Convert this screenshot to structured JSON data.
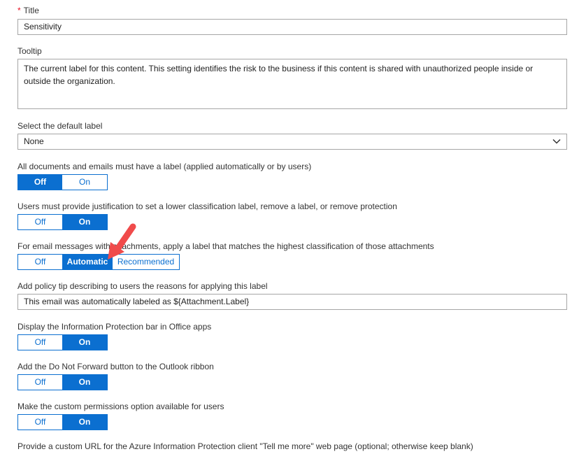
{
  "title_field": {
    "required_mark": "*",
    "label": "Title",
    "value": "Sensitivity"
  },
  "tooltip_field": {
    "label": "Tooltip",
    "value": "The current label for this content. This setting identifies the risk to the business if this content is shared with unauthorized people inside or outside the organization."
  },
  "default_label": {
    "label": "Select the default label",
    "selected": "None"
  },
  "mandatory_label": {
    "label": "All documents and emails must have a label (applied automatically or by users)",
    "off": "Off",
    "on": "On",
    "state": "Off"
  },
  "justification": {
    "label": "Users must provide justification to set a lower classification label, remove a label, or remove protection",
    "off": "Off",
    "on": "On",
    "state": "On"
  },
  "email_attachments": {
    "label": "For email messages with attachments, apply a label that matches the highest classification of those attachments",
    "off": "Off",
    "automatic": "Automatic",
    "recommended": "Recommended",
    "state": "Automatic"
  },
  "policy_tip": {
    "label": "Add policy tip describing to users the reasons for applying this label",
    "value": "This email was automatically labeled as ${Attachment.Label}"
  },
  "info_bar": {
    "label": "Display the Information Protection bar in Office apps",
    "off": "Off",
    "on": "On",
    "state": "On"
  },
  "do_not_forward": {
    "label": "Add the Do Not Forward button to the Outlook ribbon",
    "off": "Off",
    "on": "On",
    "state": "On"
  },
  "custom_permissions": {
    "label": "Make the custom permissions option available for users",
    "off": "Off",
    "on": "On",
    "state": "On"
  },
  "custom_url": {
    "label": "Provide a custom URL for the Azure Information Protection client \"Tell me more\" web page (optional; otherwise keep blank)"
  },
  "colors": {
    "accent": "#0b6fd0",
    "required": "#e81123",
    "annotation_arrow": "#f04b4b"
  }
}
